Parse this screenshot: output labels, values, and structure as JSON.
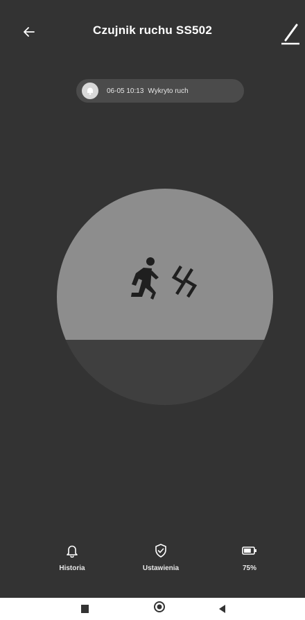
{
  "header": {
    "title": "Czujnik ruchu SS502",
    "back_icon": "arrow-left-icon",
    "edit_icon": "pencil-icon"
  },
  "event": {
    "time": "06-05 10:13",
    "text": "Wykryto ruch",
    "icon": "bell-icon"
  },
  "sensor": {
    "icon_person": "running-person-icon",
    "icon_motion": "motion-waves-icon",
    "upper_color": "#8d8d8d",
    "lower_color": "#3f3f3f"
  },
  "tabs": [
    {
      "label": "Historia",
      "icon": "bell-outline-icon"
    },
    {
      "label": "Ustawienia",
      "icon": "shield-check-icon"
    },
    {
      "label": "75%",
      "icon": "battery-icon"
    }
  ],
  "battery_percent": 75,
  "colors": {
    "background": "#333333",
    "pill": "#4b4b4b",
    "text": "#ffffff"
  }
}
